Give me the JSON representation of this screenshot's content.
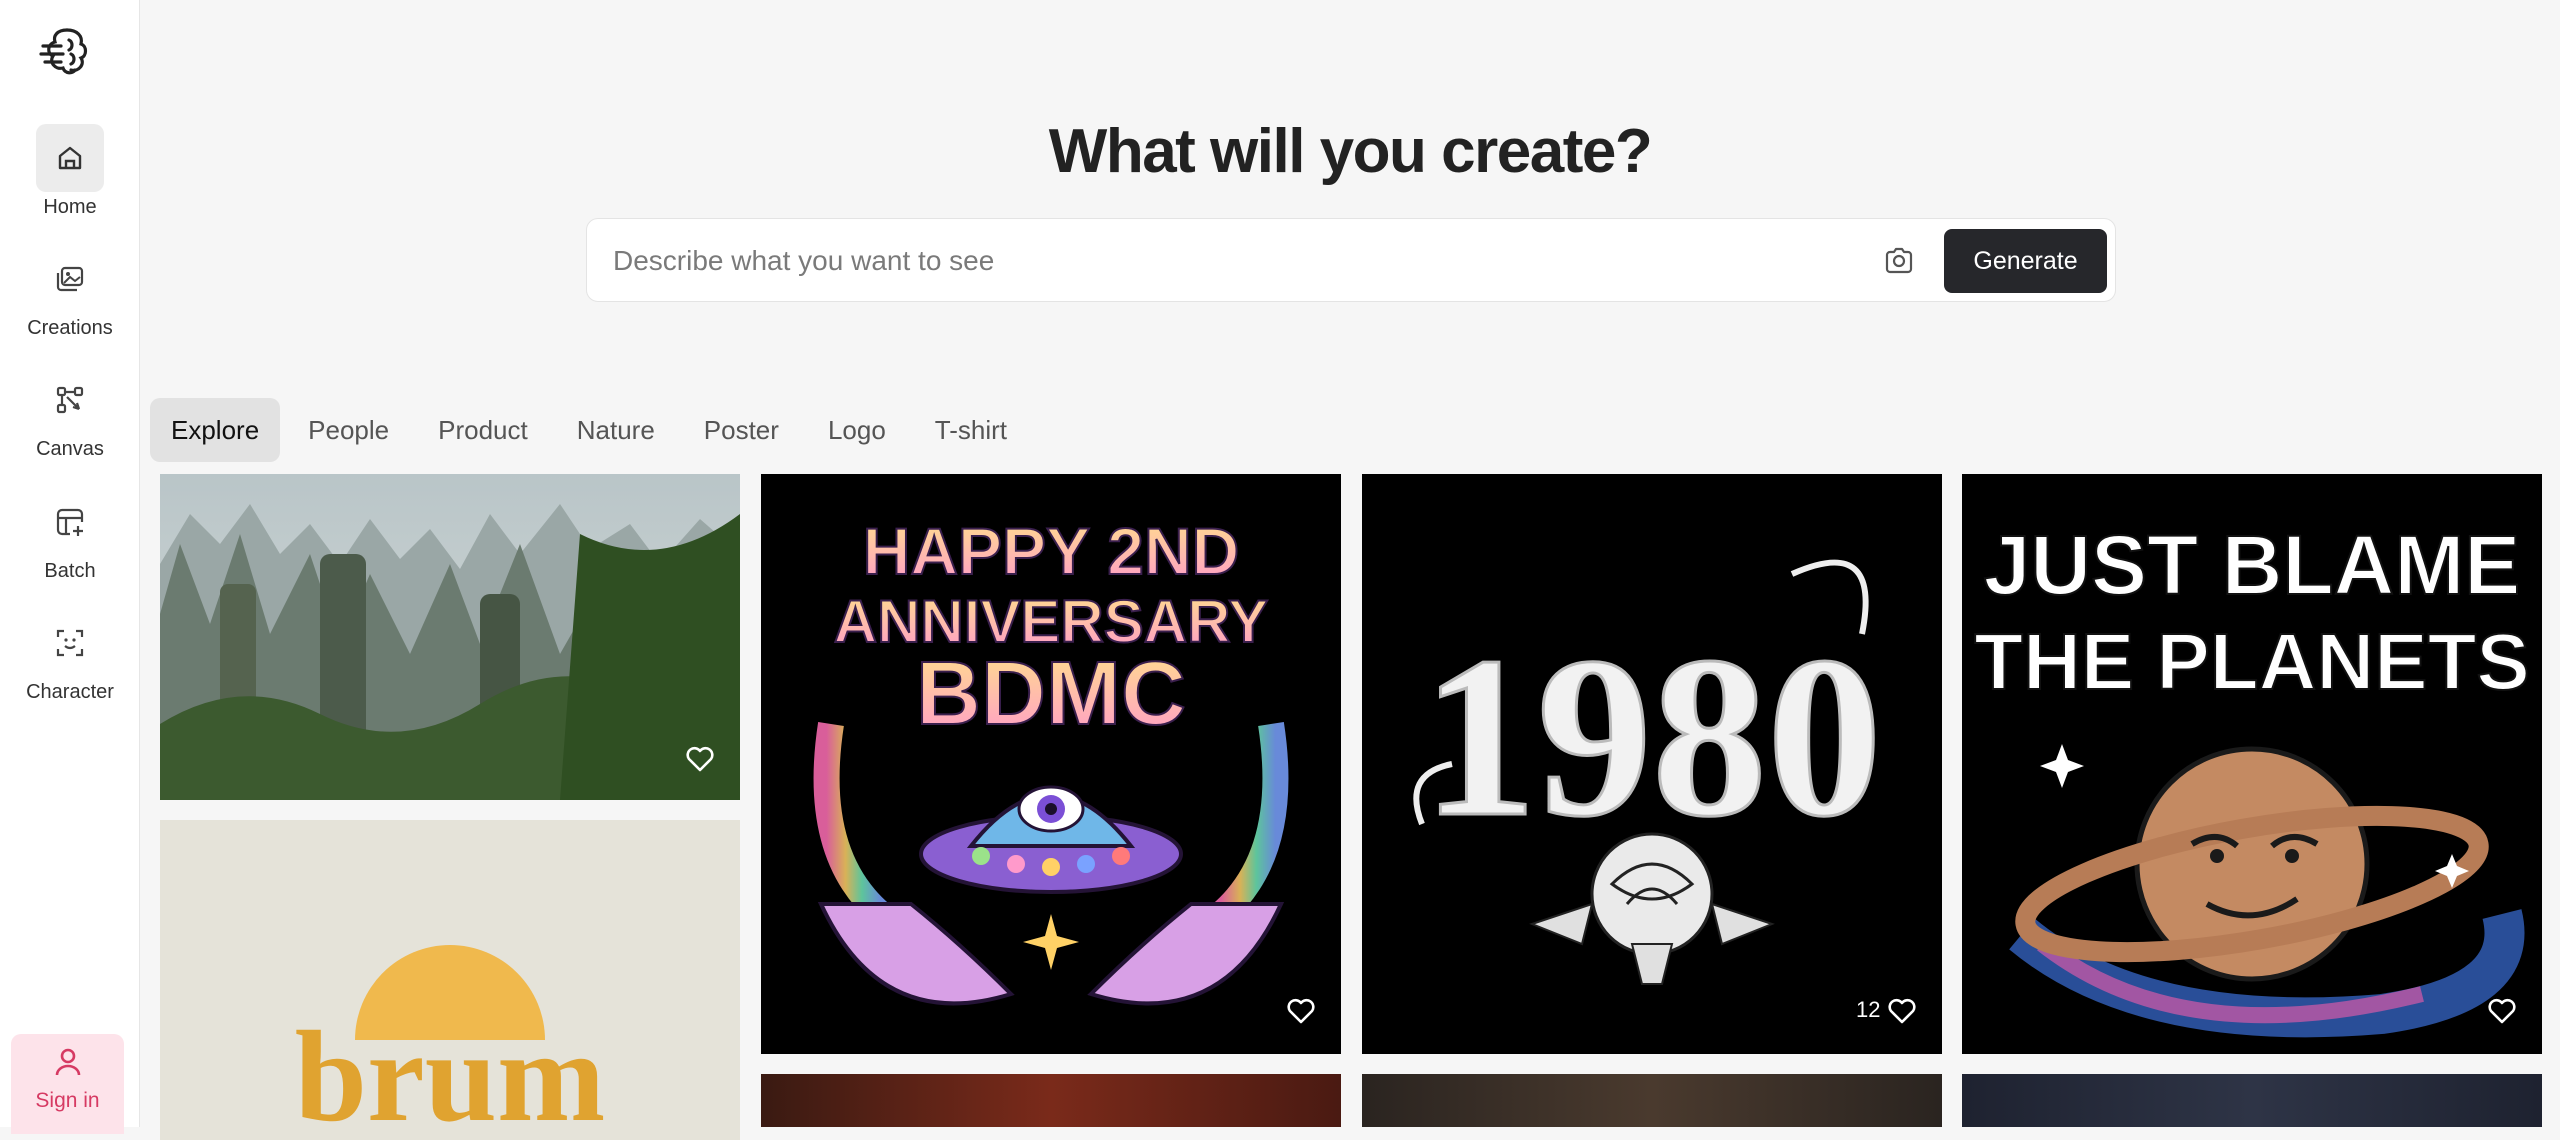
{
  "sidebar": {
    "items": [
      {
        "label": "Home",
        "icon": "home-icon",
        "active": true
      },
      {
        "label": "Creations",
        "icon": "images-icon"
      },
      {
        "label": "Canvas",
        "icon": "canvas-icon"
      },
      {
        "label": "Batch",
        "icon": "batch-icon"
      },
      {
        "label": "Character",
        "icon": "character-icon"
      }
    ],
    "sign_in": "Sign in"
  },
  "hero": {
    "title": "What will you create?"
  },
  "search": {
    "placeholder": "Describe what you want to see",
    "value": "",
    "generate_label": "Generate"
  },
  "tabs": [
    "Explore",
    "People",
    "Product",
    "Nature",
    "Poster",
    "Logo",
    "T-shirt"
  ],
  "active_tab": "Explore",
  "gallery": {
    "cards": [
      {
        "subject": "misty karst mountains"
      },
      {
        "text_lines": [
          "HAPPY 2ND",
          "ANNIVERSARY",
          "BDMC"
        ]
      },
      {
        "text": "1980",
        "likes": "12"
      },
      {
        "text_lines": [
          "JUST BLAME",
          "THE PLANETS"
        ]
      },
      {
        "text": "brum"
      }
    ]
  },
  "colors": {
    "accent_dark": "#26272b",
    "signin_bg": "#fde3ea",
    "signin_text": "#d63a63"
  }
}
